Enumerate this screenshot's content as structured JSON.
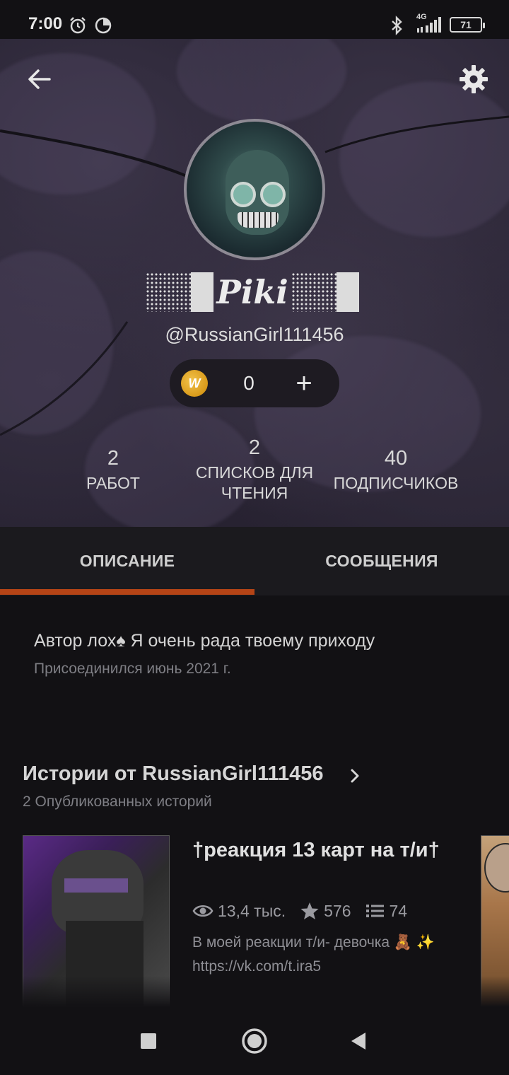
{
  "status_bar": {
    "time": "7:00",
    "battery": "71",
    "network": "4G",
    "icons": [
      "alarm-icon",
      "sync-icon",
      "bluetooth-icon",
      "signal-icon",
      "battery-icon"
    ]
  },
  "header": {
    "back_icon": "arrow-left-icon",
    "settings_icon": "gear-icon"
  },
  "profile": {
    "display_name": "Piki",
    "username": "@RussianGirl111456",
    "coins": {
      "icon_letter": "W",
      "count": "0",
      "add_label": "+"
    },
    "stats": [
      {
        "number": "2",
        "label": "РАБОТ"
      },
      {
        "number": "2",
        "label": "СПИСКОВ ДЛЯ ЧТЕНИЯ"
      },
      {
        "number": "40",
        "label": "ПОДПИСЧИКОВ"
      }
    ]
  },
  "tabs": [
    {
      "label": "ОПИСАНИЕ",
      "active": true
    },
    {
      "label": "СООБЩЕНИЯ",
      "active": false
    }
  ],
  "about": {
    "description": "Автор лох♠ Я очень рада твоему приходу",
    "joined": "Присоединился июнь 2021 г."
  },
  "stories": {
    "title": "Истории от RussianGirl111456",
    "subtitle": "2 Опубликованных историй",
    "items": [
      {
        "title": "†реакция 13 карт на т/и†",
        "reads": "13,4 тыс.",
        "votes": "576",
        "parts": "74",
        "description": "В моей реакции т/и- девочка 🧸 ✨ https://vk.com/t.ira5"
      }
    ]
  },
  "colors": {
    "accent": "#b54416",
    "background": "#121114",
    "tab_bar": "#1b1a1e",
    "coin": "#e0a42a"
  },
  "nav_bar": {
    "icons": [
      "recents-square-icon",
      "home-circle-icon",
      "back-triangle-icon"
    ]
  }
}
